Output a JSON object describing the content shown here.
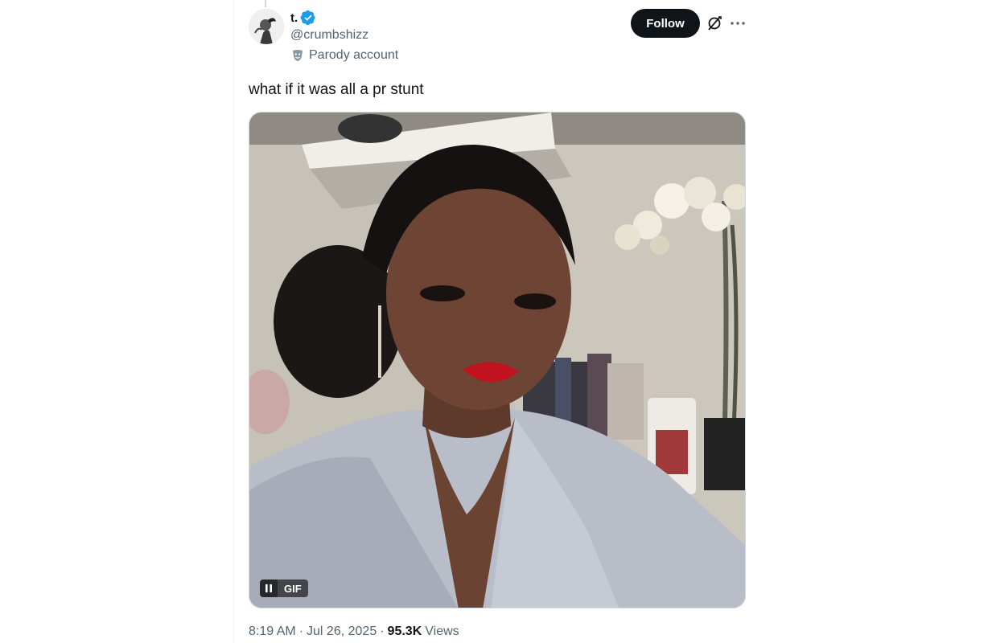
{
  "tweet": {
    "author": {
      "display_name": "t.",
      "handle": "@crumbshizz",
      "verified": true,
      "label": "Parody account"
    },
    "follow_label": "Follow",
    "text": "what if it was all a pr stunt",
    "media": {
      "type": "gif",
      "badge": "GIF"
    },
    "meta": {
      "time": "8:19 AM",
      "separator": "·",
      "date": "Jul 26, 2025",
      "views_count": "95.3K",
      "views_label": "Views"
    }
  },
  "icons": {
    "verified": "verified-badge-icon",
    "parody": "theater-mask-icon",
    "grok": "grok-icon",
    "more": "more-icon",
    "pause": "pause-icon"
  },
  "colors": {
    "primary_text": "#0f1419",
    "secondary_text": "#536471",
    "verified_blue": "#1d9bf0",
    "follow_bg": "#0f1419",
    "border": "#cfd9de"
  }
}
